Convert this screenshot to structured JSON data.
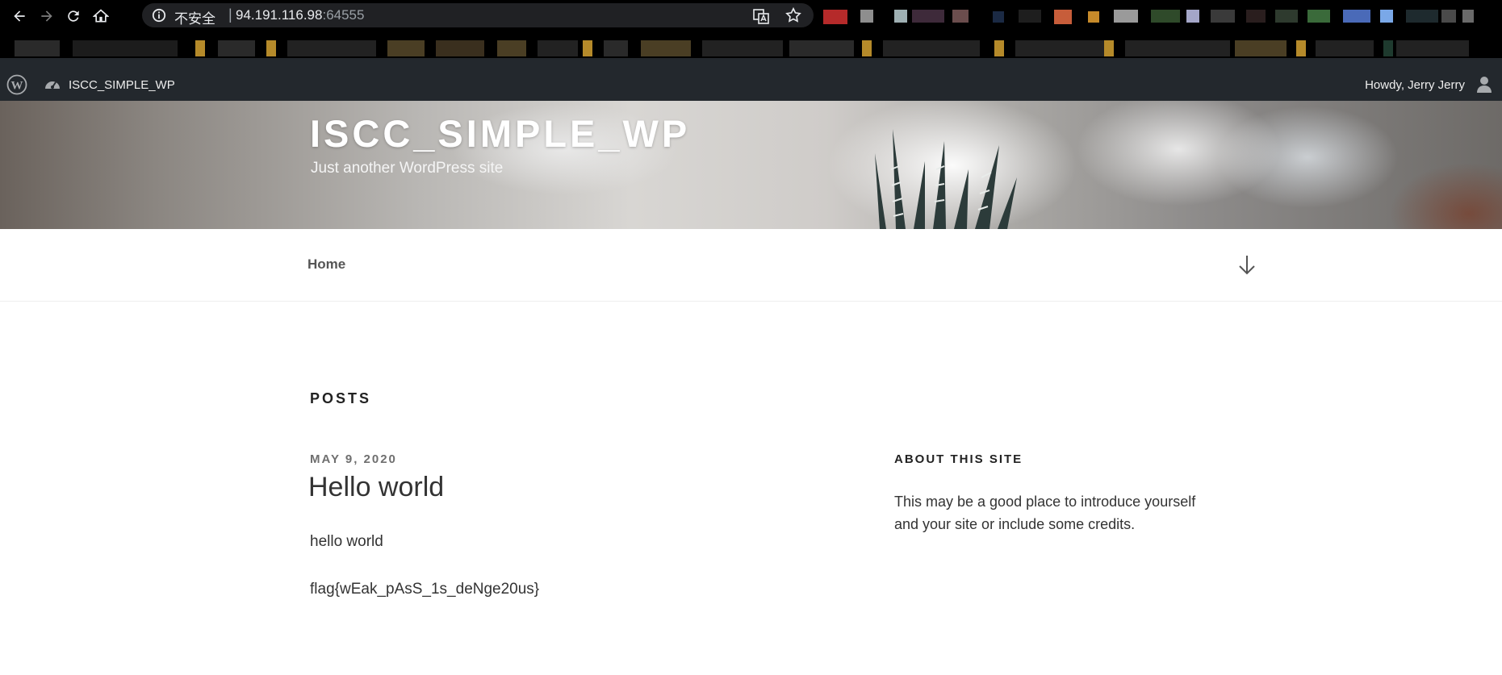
{
  "browser": {
    "security_label": "不安全",
    "url_host": "94.191.116.98",
    "url_port": ":64555",
    "colors": {
      "chrome_bg": "#000000",
      "omnibox_bg": "#202124",
      "url_text": "#e8eaed"
    },
    "icons": [
      "back-icon",
      "forward-icon",
      "reload-icon",
      "home-icon",
      "info-icon",
      "translate-icon",
      "star-icon"
    ]
  },
  "adminbar": {
    "site_name": "ISCC_SIMPLE_WP",
    "howdy": "Howdy, Jerry Jerry",
    "colors": {
      "bg": "#23282d",
      "text": "#eeeeee"
    }
  },
  "header": {
    "title": "ISCC_SIMPLE_WP",
    "description": "Just another WordPress site"
  },
  "nav": {
    "home_label": "Home"
  },
  "main": {
    "heading": "POSTS",
    "post": {
      "date": "MAY 9, 2020",
      "title": "Hello world",
      "paragraphs": [
        "hello world",
        "flag{wEak_pAsS_1s_deNge20us}"
      ]
    }
  },
  "sidebar": {
    "widget_title": "ABOUT THIS SITE",
    "widget_text": "This may be a good place to introduce yourself and your site or include some credits."
  }
}
